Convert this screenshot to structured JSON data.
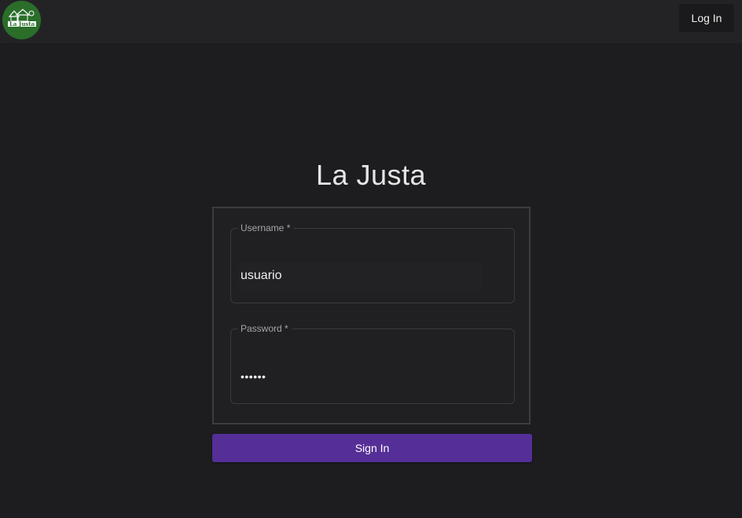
{
  "header": {
    "logo_text": "La Justa",
    "login_label": "Log In"
  },
  "main": {
    "title": "La Justa"
  },
  "form": {
    "username": {
      "label": "Username *",
      "value": "usuario"
    },
    "password": {
      "label": "Password *",
      "value": "••••••"
    },
    "submit_label": "Sign In"
  },
  "colors": {
    "background": "#1d1d20",
    "topbar": "#232326",
    "logo_green": "#2a6e2a",
    "primary_button": "#552e97"
  },
  "icons": {
    "logo": "la-justa-logo-icon"
  }
}
